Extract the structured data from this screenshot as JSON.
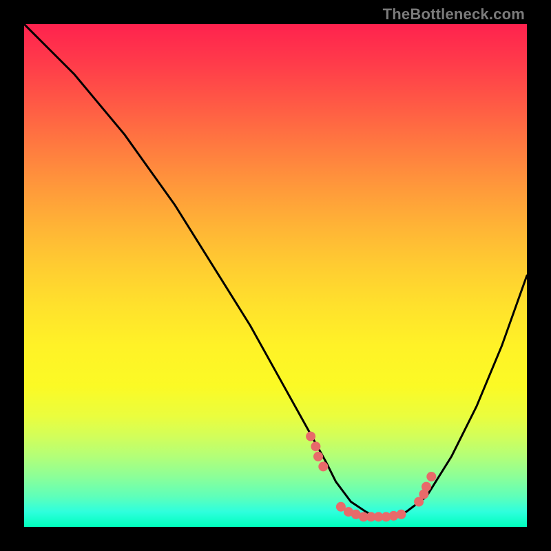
{
  "watermark": "TheBottleneck.com",
  "chart_data": {
    "type": "line",
    "title": "",
    "xlabel": "",
    "ylabel": "",
    "xlim": [
      0,
      100
    ],
    "ylim": [
      0,
      100
    ],
    "curve": {
      "name": "bottleneck-curve",
      "x": [
        0,
        5,
        10,
        15,
        20,
        25,
        30,
        35,
        40,
        45,
        50,
        55,
        60,
        62,
        65,
        68,
        70,
        73,
        76,
        80,
        85,
        90,
        95,
        100
      ],
      "y": [
        100,
        95,
        90,
        84,
        78,
        71,
        64,
        56,
        48,
        40,
        31,
        22,
        13,
        9,
        5,
        3,
        2,
        2,
        3,
        6,
        14,
        24,
        36,
        50
      ]
    },
    "markers": {
      "name": "data-points",
      "color": "#e86a6a",
      "x": [
        57,
        58,
        58.5,
        59.5,
        63,
        64.5,
        66,
        67.5,
        69,
        70.5,
        72,
        73.5,
        75,
        78.5,
        79.5,
        80,
        81
      ],
      "y": [
        18,
        16,
        14,
        12,
        4,
        3,
        2.5,
        2,
        2,
        2,
        2,
        2.2,
        2.5,
        5,
        6.5,
        8,
        10
      ]
    },
    "background_gradient": {
      "top": "#ff224e",
      "middle": "#ffe12c",
      "bottom": "#00ffbd"
    }
  }
}
